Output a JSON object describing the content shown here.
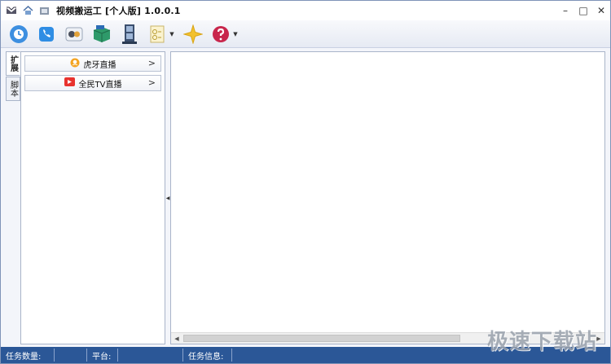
{
  "window": {
    "title": "视频搬运工 [个人版] 1.0.0.1",
    "minimize_glyph": "–",
    "maximize_glyph": "□",
    "close_glyph": "✕"
  },
  "toolbar": {
    "tools": [
      "refresh-icon",
      "phone-icon",
      "camera-icon",
      "cube-icon",
      "film-icon",
      "notes-icon",
      "star-icon",
      "help-icon"
    ]
  },
  "side_tabs": [
    {
      "label": "扩展",
      "active": true
    },
    {
      "label": "脚本",
      "active": false
    }
  ],
  "platforms": [
    {
      "label": "虎牙直播",
      "icon": "huya-icon"
    },
    {
      "label": "全民TV直播",
      "icon": "quanmin-icon"
    }
  ],
  "status": {
    "task_count_label": "任务数量:",
    "platform_label": "平台:",
    "task_info_label": "任务信息:"
  },
  "watermark": "极速下载站",
  "colors": {
    "statusbar": "#2b5797",
    "accent": "#2b5797"
  }
}
